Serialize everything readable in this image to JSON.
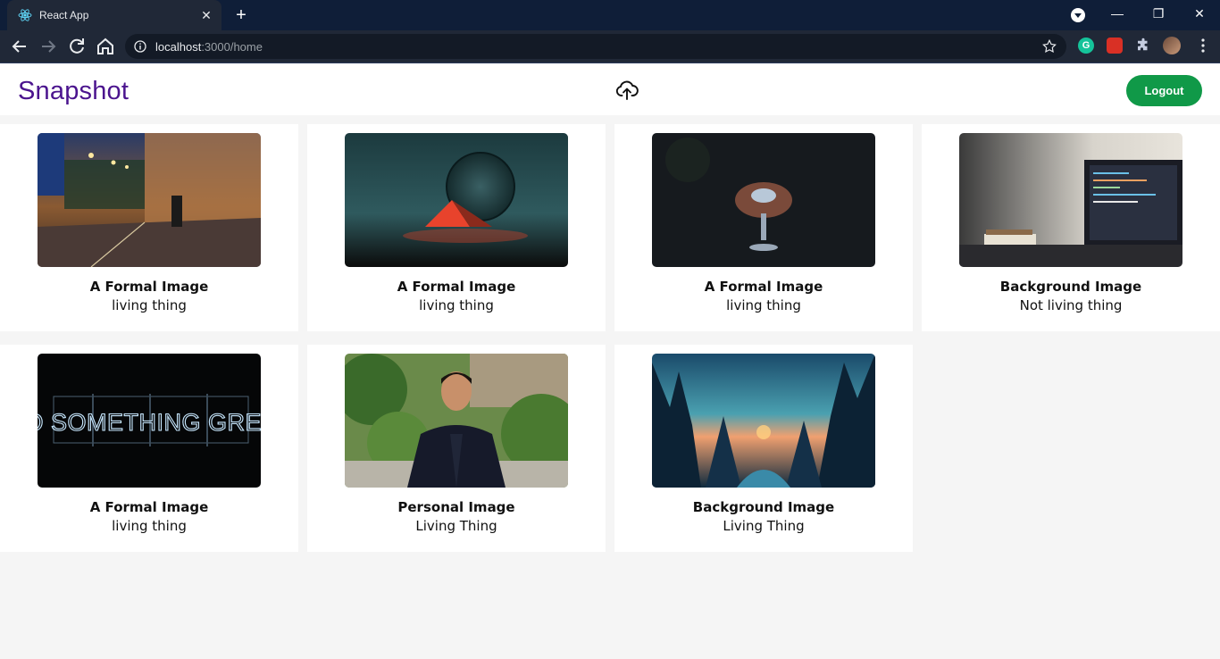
{
  "browser": {
    "tab_title": "React App",
    "new_tab": "+",
    "url_host": "localhost",
    "url_rest": ":3000/home",
    "ext_grammarly": "G",
    "window_controls": {
      "minimize": "—",
      "restore": "❐",
      "close": "✕"
    }
  },
  "header": {
    "logo": "Snapshot",
    "logout_label": "Logout"
  },
  "cards": [
    {
      "title": "A Formal Image",
      "subtitle": "living thing",
      "image": "night street with cyclist"
    },
    {
      "title": "A Formal Image",
      "subtitle": "living thing",
      "image": "glass sphere with red prism"
    },
    {
      "title": "A Formal Image",
      "subtitle": "living thing",
      "image": "hands holding a glass"
    },
    {
      "title": "Background Image",
      "subtitle": "Not living thing",
      "image": "laptop on desk"
    },
    {
      "title": "A Formal Image",
      "subtitle": "living thing",
      "image": "neon sign DO SOMETHING GREAT"
    },
    {
      "title": "Personal Image",
      "subtitle": "Living Thing",
      "image": "man in suit among plants"
    },
    {
      "title": "Background Image",
      "subtitle": "Living Thing",
      "image": "forest landscape at sunset"
    }
  ],
  "neon_text": "DO SOMETHING GREAT",
  "colors": {
    "accent": "#4b148e",
    "logout": "#109948"
  }
}
